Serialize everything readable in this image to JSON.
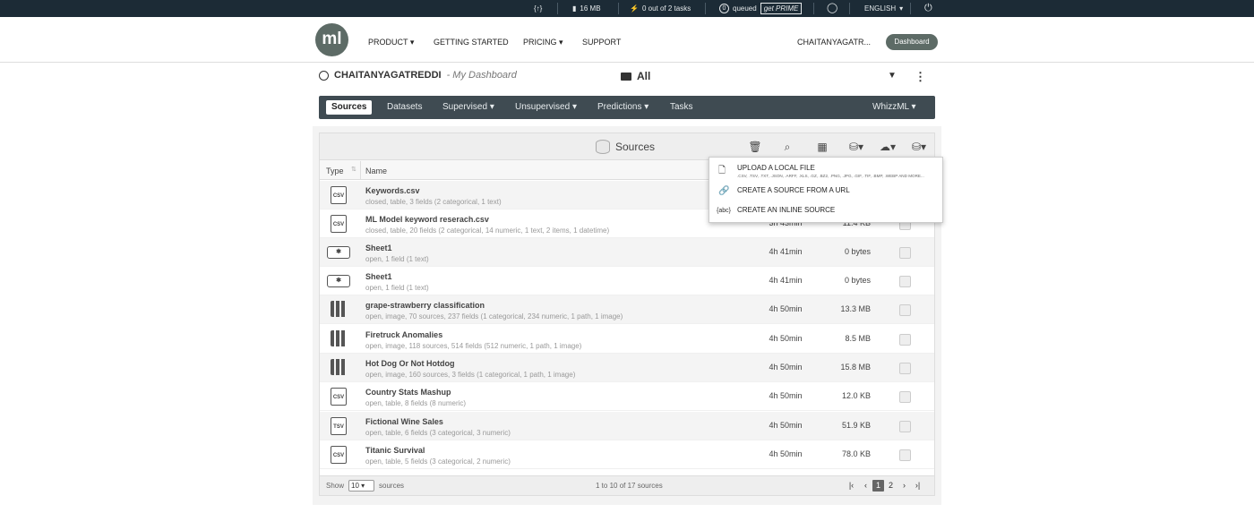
{
  "topbar": {
    "api_badge": "{↑}",
    "storage": "16 MB",
    "tasks": "0 out of 2 tasks",
    "queued_count": "0",
    "queued": "queued",
    "prime": "get PRIME",
    "language": "ENGLISH"
  },
  "navbar": {
    "logo": "ml",
    "product": "PRODUCT",
    "getting_started": "GETTING STARTED",
    "pricing": "PRICING",
    "support": "SUPPORT",
    "user": "CHAITANYAGATR...",
    "dashboard": "Dashboard"
  },
  "dashboard": {
    "user": "CHAITANYAGATREDDI",
    "subtitle": "- My Dashboard",
    "folder": "All"
  },
  "tabs": {
    "sources": "Sources",
    "datasets": "Datasets",
    "supervised": "Supervised",
    "unsupervised": "Unsupervised",
    "predictions": "Predictions",
    "tasks": "Tasks",
    "whizzml": "WhizzML"
  },
  "table": {
    "title": "Sources",
    "col_type": "Type",
    "col_name": "Name",
    "rows": [
      {
        "icon": "CSV",
        "name": "Keywords.csv",
        "desc": "closed, table, 3 fields (2 categorical, 1 text)",
        "age": "",
        "size": ""
      },
      {
        "icon": "CSV",
        "name": "ML Model keyword reserach.csv",
        "desc": "closed, table, 20 fields (2 categorical, 14 numeric, 1 text, 2 items, 1 datetime)",
        "age": "3h 43min",
        "size": "11.4 KB"
      },
      {
        "icon": "SHEET",
        "name": "Sheet1",
        "desc": "open, 1 field (1 text)",
        "age": "4h 41min",
        "size": "0 bytes"
      },
      {
        "icon": "SHEET",
        "name": "Sheet1",
        "desc": "open, 1 field (1 text)",
        "age": "4h 41min",
        "size": "0 bytes"
      },
      {
        "icon": "IMG",
        "name": "grape-strawberry classification",
        "desc": "open, image, 70 sources, 237 fields (1 categorical, 234 numeric, 1 path, 1 image)",
        "age": "4h 50min",
        "size": "13.3 MB"
      },
      {
        "icon": "IMG",
        "name": "Firetruck Anomalies",
        "desc": "open, image, 118 sources, 514 fields (512 numeric, 1 path, 1 image)",
        "age": "4h 50min",
        "size": "8.5 MB"
      },
      {
        "icon": "IMG",
        "name": "Hot Dog Or Not Hotdog",
        "desc": "open, image, 160 sources, 3 fields (1 categorical, 1 path, 1 image)",
        "age": "4h 50min",
        "size": "15.8 MB"
      },
      {
        "icon": "CSV",
        "name": "Country Stats Mashup",
        "desc": "open, table, 8 fields (8 numeric)",
        "age": "4h 50min",
        "size": "12.0 KB"
      },
      {
        "icon": "TSV",
        "name": "Fictional Wine Sales",
        "desc": "open, table, 6 fields (3 categorical, 3 numeric)",
        "age": "4h 50min",
        "size": "51.9 KB"
      },
      {
        "icon": "CSV",
        "name": "Titanic Survival",
        "desc": "open, table, 5 fields (3 categorical, 2 numeric)",
        "age": "4h 50min",
        "size": "78.0 KB"
      }
    ]
  },
  "footer": {
    "show": "Show",
    "per_page": "10",
    "sources": "sources",
    "range": "1 to 10 of 17 sources",
    "page1": "1",
    "page2": "2"
  },
  "dropdown": {
    "upload_label": "UPLOAD A LOCAL FILE",
    "upload_sub": ".CSV, .TSV, .TXT, .JSON, .ARFF, .XLS, .GZ, .BZ2, .PNG, .JPG, .GIF, .TIF, .BMP, .WEBP AND MORE...",
    "url_label": "CREATE A SOURCE FROM A URL",
    "inline_label": "CREATE AN INLINE SOURCE"
  }
}
